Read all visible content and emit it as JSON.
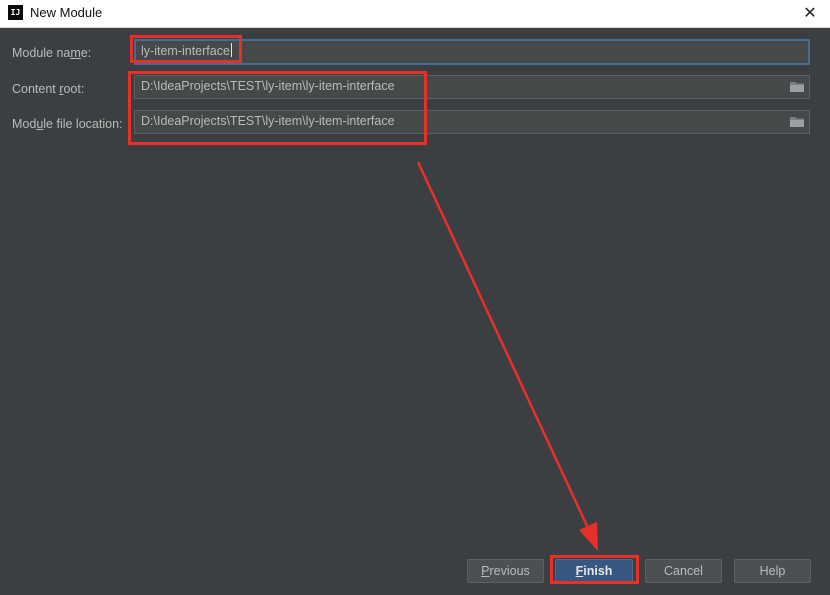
{
  "window": {
    "title": "New Module",
    "logo_text": "IJ",
    "close_glyph": "✕"
  },
  "form": {
    "module_name": {
      "label_pre": "Module na",
      "label_mn": "m",
      "label_post": "e:",
      "value": "ly-item-interface"
    },
    "content_root": {
      "label_pre": "Content ",
      "label_mn": "r",
      "label_post": "oot:",
      "value": "D:\\IdeaProjects\\TEST\\ly-item\\ly-item-interface"
    },
    "module_file_location": {
      "label_pre": "Mod",
      "label_mn": "u",
      "label_post": "le file location:",
      "value": "D:\\IdeaProjects\\TEST\\ly-item\\ly-item-interface"
    }
  },
  "buttons": {
    "previous": {
      "mn": "P",
      "rest": "revious"
    },
    "finish": {
      "mn": "F",
      "rest": "inish"
    },
    "cancel": "Cancel",
    "help": "Help"
  },
  "icons": {
    "browse": "folder-icon"
  },
  "colors": {
    "background": "#3c3f41",
    "annotation": "#e8302a",
    "focus_border": "#466d94",
    "primary_button": "#365880"
  }
}
